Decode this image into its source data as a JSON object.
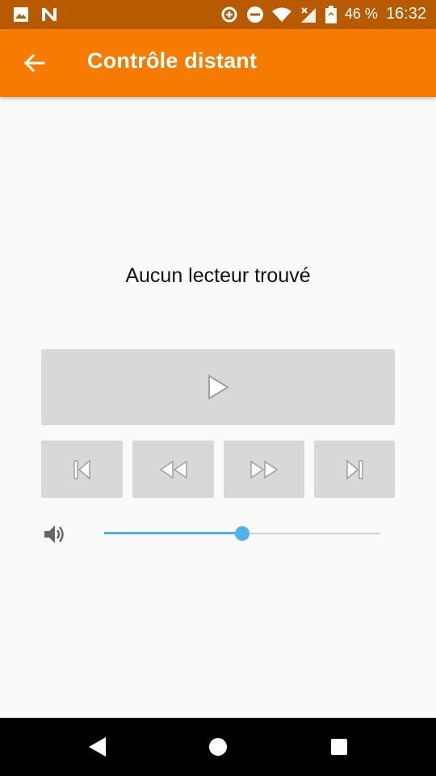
{
  "status_bar": {
    "battery": "46 %",
    "time": "16:32",
    "icons": [
      "image-icon",
      "n-logo-icon",
      "data-saver-icon",
      "do-not-disturb-icon",
      "wifi-icon",
      "signal-icon",
      "battery-icon"
    ]
  },
  "app_bar": {
    "title": "Contrôle distant",
    "back_icon": "arrow-back-icon"
  },
  "main": {
    "empty_message": "Aucun lecteur trouvé",
    "controls": {
      "play_icon": "play-icon",
      "previous_icon": "skip-previous-icon",
      "rewind_icon": "rewind-icon",
      "forward_icon": "fast-forward-icon",
      "next_icon": "skip-next-icon"
    },
    "volume": {
      "icon": "volume-icon",
      "level": 0.5,
      "accent_color": "#4fb3ea"
    }
  },
  "nav_bar": {
    "back_icon": "nav-back-icon",
    "home_icon": "nav-home-icon",
    "recents_icon": "nav-recents-icon"
  },
  "colors": {
    "app_bar": "#f57c00",
    "status_bar": "#b85a00",
    "control_bg": "#d7d8d8"
  }
}
